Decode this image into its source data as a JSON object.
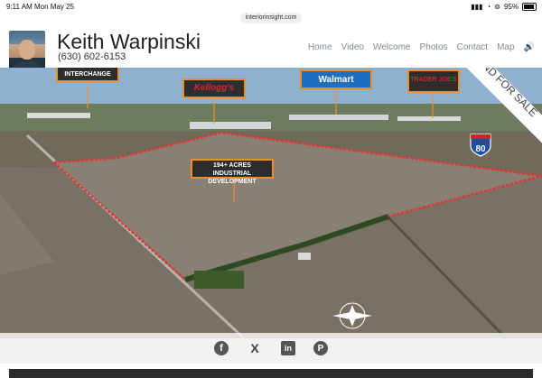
{
  "status": {
    "time": "9:11 AM",
    "date": "Mon May 25",
    "battery": "95%"
  },
  "browser": {
    "url": "interiorinsight.com"
  },
  "header": {
    "name": "Keith Warpinski",
    "phone": "(630) 602-6153"
  },
  "nav": {
    "home": "Home",
    "video": "Video",
    "welcome": "Welcome",
    "photos": "Photos",
    "contact": "Contact",
    "map": "Map"
  },
  "hero": {
    "callout_interchange": "INTERCHANGE",
    "callout_logo1": "Kellogg's",
    "callout_walmart": "Walmart",
    "callout_logo3": "TRADER JOE'S",
    "callout_development": "194+ ACRES\nINDUSTRIAL DEVELOPMENT",
    "banner": "LAND FOR SALE",
    "interstate": "80"
  },
  "social": {
    "facebook": "f",
    "x": "X",
    "linkedin": "in",
    "pinterest": "P"
  }
}
